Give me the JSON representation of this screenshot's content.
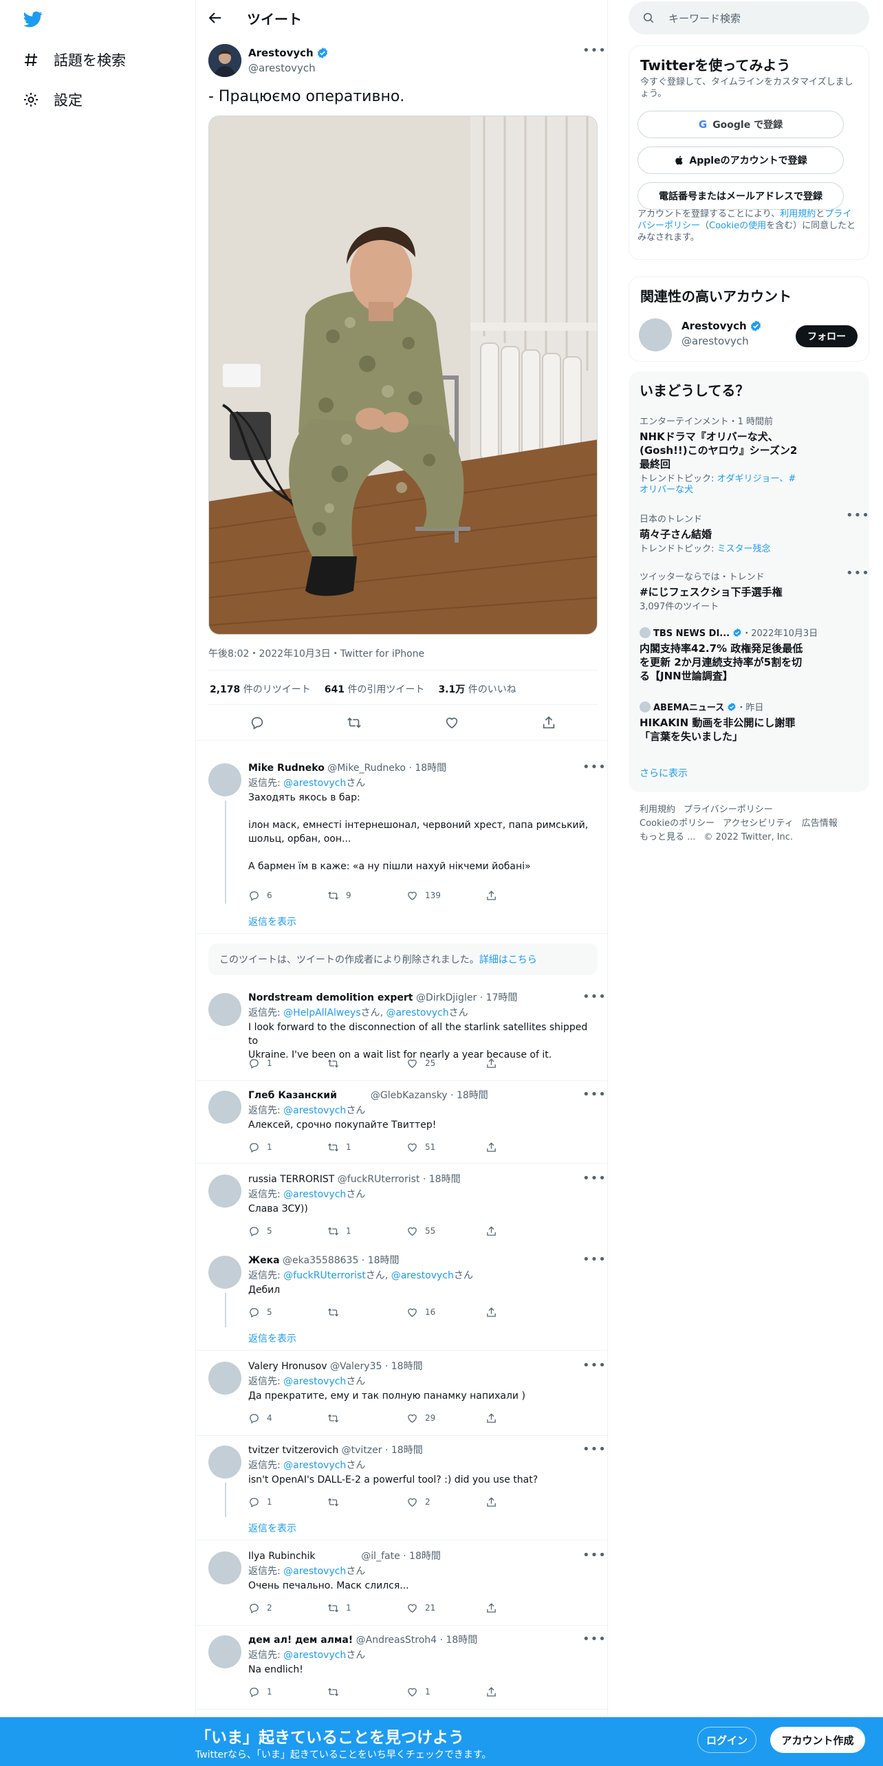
{
  "nav": {
    "explore": "話題を検索",
    "settings": "設定"
  },
  "header": {
    "title": "ツイート"
  },
  "tweet": {
    "author_name": "Arestovych",
    "author_handle": "@arestovych",
    "text": "- Працюємо оперативно.",
    "meta": "午後8:02・2022年10月3日・Twitter for iPhone",
    "retweets_count": "2,178",
    "retweets_label": "件のリツイート",
    "quotes_count": "641",
    "quotes_label": "件の引用ツイート",
    "likes_count": "3.1万",
    "likes_label": "件のいいね"
  },
  "reply_to_label": "返信先:",
  "san": "さん",
  "show_replies": "返信を表示",
  "deleted_notice": {
    "text": "このツイートは、ツイートの作成者により削除されました。",
    "link": "詳細はこちら"
  },
  "replies": [
    {
      "name": "Mike Rudneko",
      "handle": "@Mike_Rudneko",
      "time": "18時間",
      "to": [
        "@arestovych"
      ],
      "lines": [
        "Заходять якось в бар:",
        "",
        "ілон маск, емнесті інтернешонал, червоний хрест, папа римський,",
        "шольц, орбан, оон...",
        "",
        "А бармен їм в каже: «а ну пішли нахуй нікчеми йобані»"
      ],
      "replies": "6",
      "retweets": "9",
      "likes": "139"
    },
    {
      "name": "Nordstream demolition expert",
      "handle": "@DirkDjigler",
      "time": "17時間",
      "to": [
        "@HelpAllAlweys",
        "@arestovych"
      ],
      "lines": [
        "I look forward to the disconnection of all the starlink satellites shipped to",
        "Ukraine.  I've been on a wait list for nearly a year because of it."
      ],
      "replies": "1",
      "retweets": "",
      "likes": "25"
    },
    {
      "name": "Глеб Казанский",
      "handle": "@GlebKazansky",
      "time": "18時間",
      "to": [
        "@arestovych"
      ],
      "lines": [
        "Алексей, срочно покупайте Твиттер!"
      ],
      "replies": "1",
      "retweets": "1",
      "likes": "51"
    },
    {
      "name": "russia TERRORIST",
      "handle": "@fuckRUterrorist",
      "time": "18時間",
      "to": [
        "@arestovych"
      ],
      "lines": [
        "Слава ЗСУ))"
      ],
      "replies": "5",
      "retweets": "1",
      "likes": "55"
    },
    {
      "name": "Жека",
      "handle": "@eka35588635",
      "time": "18時間",
      "to": [
        "@fuckRUterrorist",
        "@arestovych"
      ],
      "lines": [
        "Дебил"
      ],
      "replies": "5",
      "retweets": "",
      "likes": "16"
    },
    {
      "name": "Valery Hronusov",
      "handle": "@Valery35",
      "time": "18時間",
      "to": [
        "@arestovych"
      ],
      "lines": [
        "Да прекратите, ему и так полную панамку напихали )"
      ],
      "replies": "4",
      "retweets": "",
      "likes": "29"
    },
    {
      "name": "tvitzer tvitzerovich",
      "handle": "@tvitzer",
      "time": "18時間",
      "to": [
        "@arestovych"
      ],
      "lines": [
        "isn't OpenAI's DALL-E-2 a powerful tool? :)  did you use that?"
      ],
      "replies": "1",
      "retweets": "",
      "likes": "2"
    },
    {
      "name": "Ilya Rubinchik",
      "handle": "@il_fate",
      "time": "18時間",
      "to": [
        "@arestovych"
      ],
      "lines": [
        "Очень печально. Маск слился..."
      ],
      "replies": "2",
      "retweets": "1",
      "likes": "21"
    },
    {
      "name": "дем ал! дем алма!",
      "handle": "@AndreasStroh4",
      "time": "18時間",
      "to": [
        "@arestovych"
      ],
      "lines": [
        "Na endlich!"
      ],
      "replies": "1",
      "retweets": "",
      "likes": "1"
    }
  ],
  "right": {
    "search_placeholder": "キーワード検索",
    "signup": {
      "title": "Twitterを使ってみよう",
      "subtitle": "今すぐ登録して、タイムラインをカスタマイズしましょう。",
      "google": "Google で登録",
      "apple": "Appleのアカウントで登録",
      "phone": "電話番号またはメールアドレスで登録",
      "terms_1": "アカウントを登録することにより、",
      "terms_link_1": "利用規約",
      "terms_2": "と",
      "terms_link_2": "プライバシーポリシー",
      "terms_3": "（",
      "terms_link_3": "Cookieの使用",
      "terms_4": "を含む）に同意したとみなされます。"
    },
    "related": {
      "title": "関連性の高いアカウント",
      "name": "Arestovych",
      "handle": "@arestovych",
      "follow": "フォロー"
    },
    "trends": {
      "title": "いまどうしてる？",
      "items": [
        {
          "cat": "エンターテインメント・1 時間前",
          "title": "NHKドラマ『オリバーな犬、(Gosh!!)このヤロウ』シーズン2 最終回",
          "sub_label": "トレンドトピック: ",
          "sub_links": "オダギリジョー、#オリバーな犬"
        },
        {
          "cat": "日本のトレンド",
          "title": "萌々子さん結婚",
          "sub_label": "トレンドトピック: ",
          "sub_links": "ミスター残念"
        },
        {
          "cat": "ツイッターならでは・トレンド",
          "title": "#にじフェスクショ下手選手権",
          "sub_label": "3,097件のツイート",
          "sub_links": ""
        },
        {
          "cat_src": "TBS NEWS DI...",
          "cat_time": "・2022年10月3日",
          "title": "内閣支持率42.7% 政権発足後最低を更新 2か月連続支持率が5割を切る【JNN世論調査】"
        },
        {
          "cat_src": "ABEMAニュース",
          "cat_time": "・昨日",
          "title": "HIKAKIN 動画を非公開にし謝罪「言葉を失いました」"
        }
      ],
      "show_more": "さらに表示"
    },
    "footer": {
      "terms": "利用規約",
      "privacy": "プライバシーポリシー",
      "cookie": "Cookieのポリシー",
      "accessibility": "アクセシビリティ",
      "ads": "広告情報",
      "more": "もっと見る ...",
      "copyright": "© 2022 Twitter, Inc."
    }
  },
  "bottom": {
    "title": "「いま」起きていることを見つけよう",
    "subtitle": "Twitterなら、「いま」起きていることをいち早くチェックできます。",
    "login": "ログイン",
    "signup": "アカウント作成"
  },
  "colors": {
    "accent": "#1d9bf0",
    "text": "#0f1419",
    "muted": "#536471"
  }
}
